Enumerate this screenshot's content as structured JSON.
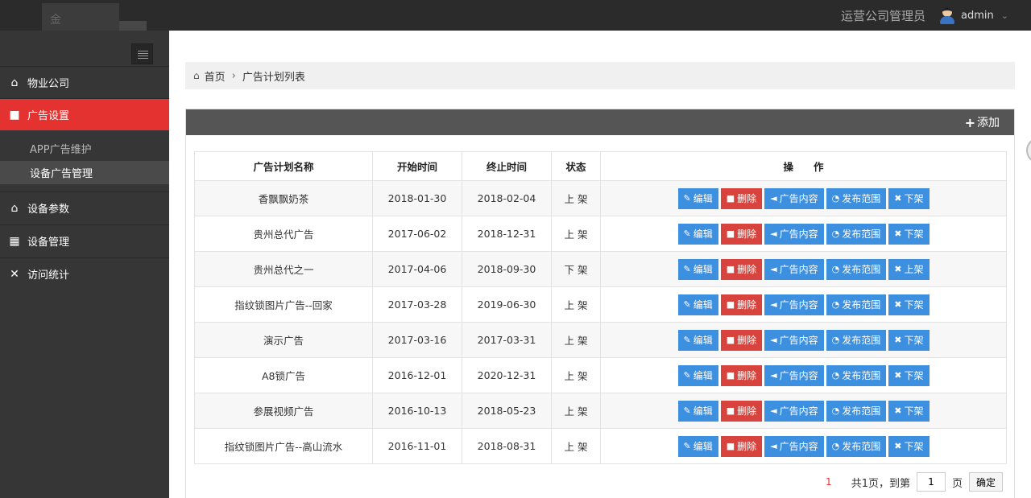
{
  "header": {
    "role": "运营公司管理员",
    "user": "admin",
    "logo_glyph": "金"
  },
  "sidebar": {
    "items": [
      {
        "label": "物业公司",
        "icon": "home-icon"
      },
      {
        "label": "广告设置",
        "icon": "ad-icon",
        "active": true
      },
      {
        "label": "设备参数",
        "icon": "home-icon"
      },
      {
        "label": "设备管理",
        "icon": "grid-icon"
      },
      {
        "label": "访问统计",
        "icon": "close-icon"
      }
    ],
    "sub_items": [
      {
        "label": "APP广告维护"
      },
      {
        "label": "设备广告管理",
        "active": true
      }
    ]
  },
  "breadcrumb": {
    "home": "首页",
    "current": "广告计划列表"
  },
  "panel": {
    "add_label": "添加"
  },
  "table": {
    "headers": [
      "广告计划名称",
      "开始时间",
      "终止时间",
      "状态",
      "操　　作"
    ],
    "rows": [
      {
        "name": "香飘飘奶茶",
        "start": "2018-01-30",
        "end": "2018-02-04",
        "status": "上 架",
        "toggle": "下架"
      },
      {
        "name": "贵州总代广告",
        "start": "2017-06-02",
        "end": "2018-12-31",
        "status": "上 架",
        "toggle": "下架"
      },
      {
        "name": "贵州总代之一",
        "start": "2017-04-06",
        "end": "2018-09-30",
        "status": "下 架",
        "toggle": "上架"
      },
      {
        "name": "指纹锁图片广告--回家",
        "start": "2017-03-28",
        "end": "2019-06-30",
        "status": "上 架",
        "toggle": "下架"
      },
      {
        "name": "演示广告",
        "start": "2017-03-16",
        "end": "2017-03-31",
        "status": "上 架",
        "toggle": "下架"
      },
      {
        "name": "A8锁广告",
        "start": "2016-12-01",
        "end": "2020-12-31",
        "status": "上 架",
        "toggle": "下架"
      },
      {
        "name": "参展视频广告",
        "start": "2016-10-13",
        "end": "2018-05-23",
        "status": "上 架",
        "toggle": "下架"
      },
      {
        "name": "指纹锁图片广告--高山流水",
        "start": "2016-11-01",
        "end": "2018-08-31",
        "status": "上 架",
        "toggle": "下架"
      }
    ],
    "actions": {
      "edit": "编辑",
      "delete": "删除",
      "content": "广告内容",
      "scope": "发布范围"
    }
  },
  "pager": {
    "current": "1",
    "summary": "共1页，到第",
    "input_value": "1",
    "unit": "页",
    "confirm": "确定"
  },
  "colors": {
    "accent": "#e3322f",
    "button_blue": "#3d8fe0",
    "button_red": "#d9433d",
    "topbar": "#2b2b2b",
    "sidebar": "#363636"
  }
}
